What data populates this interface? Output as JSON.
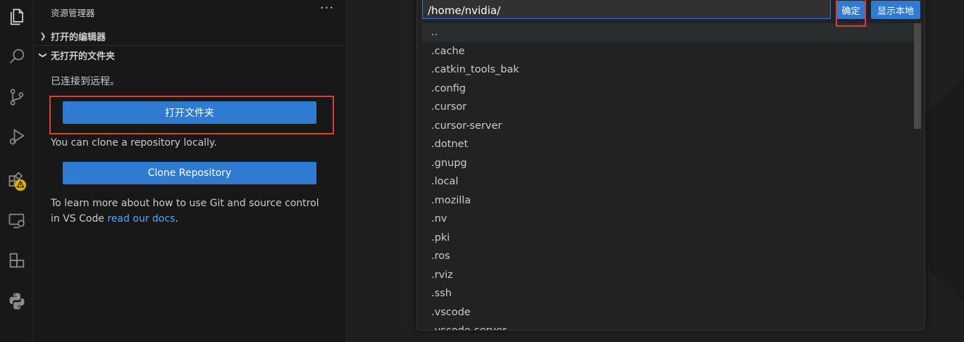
{
  "sidebar": {
    "title": "资源管理器",
    "more": "···",
    "sections": [
      {
        "label": "打开的编辑器"
      },
      {
        "label": "无打开的文件夹"
      }
    ],
    "connected_text": "已连接到远程。",
    "open_folder_button": "打开文件夹",
    "clone_hint": "You can clone a repository locally.",
    "clone_button": "Clone Repository",
    "git_help_line1": "To learn more about how to use Git and source control",
    "git_help_line2_prefix": "in VS Code ",
    "git_help_link": "read our docs",
    "git_help_suffix": "."
  },
  "activity_bar": {
    "icons": [
      "explorer-icon",
      "search-icon",
      "source-control-icon",
      "run-debug-icon",
      "extensions-icon",
      "remote-explorer-icon",
      "containers-icon",
      "python-icon"
    ]
  },
  "quick_pick": {
    "input_value": "/home/nvidia/",
    "ok_button": "确定",
    "show_local_button": "显示本地",
    "items": [
      "..",
      ".cache",
      ".catkin_tools_bak",
      ".config",
      ".cursor",
      ".cursor-server",
      ".dotnet",
      ".gnupg",
      ".local",
      ".mozilla",
      ".nv",
      ".pki",
      ".ros",
      ".rviz",
      ".ssh",
      ".vscode",
      ".vscode-server"
    ]
  },
  "colors": {
    "accent": "#2f7bd2",
    "highlight_box": "#e53935",
    "link": "#4daafc",
    "warning_badge": "#e0b000"
  }
}
